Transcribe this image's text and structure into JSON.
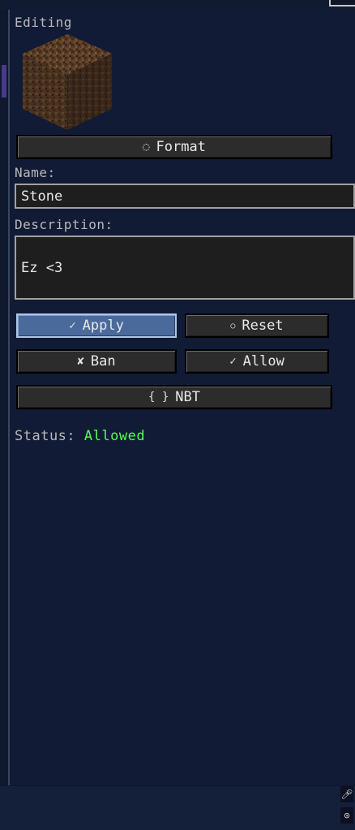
{
  "header": {
    "editing_label": "Editing"
  },
  "item": {
    "icon": "dirt-block-icon"
  },
  "buttons": {
    "format": {
      "icon": "palette-icon",
      "label": "Format"
    },
    "apply": {
      "icon": "checkmark-icon",
      "label": "Apply"
    },
    "reset": {
      "icon": "reset-icon",
      "label": "Reset"
    },
    "ban": {
      "icon": "cross-icon",
      "label": "Ban"
    },
    "allow": {
      "icon": "check-icon",
      "label": "Allow"
    },
    "nbt": {
      "icon": "braces-icon",
      "label": "NBT"
    }
  },
  "fields": {
    "name_label": "Name:",
    "name_value": "Stone",
    "description_label": "Description:",
    "description_value": "Ez <3"
  },
  "status": {
    "label": "Status:",
    "value": "Allowed",
    "value_color": "#55ff55"
  },
  "corner_icons": [
    "microphone-icon",
    "settings-icon"
  ],
  "colors": {
    "background": "#111b35",
    "button": "#2c2c2c",
    "button_active": "#4a6a9c"
  }
}
